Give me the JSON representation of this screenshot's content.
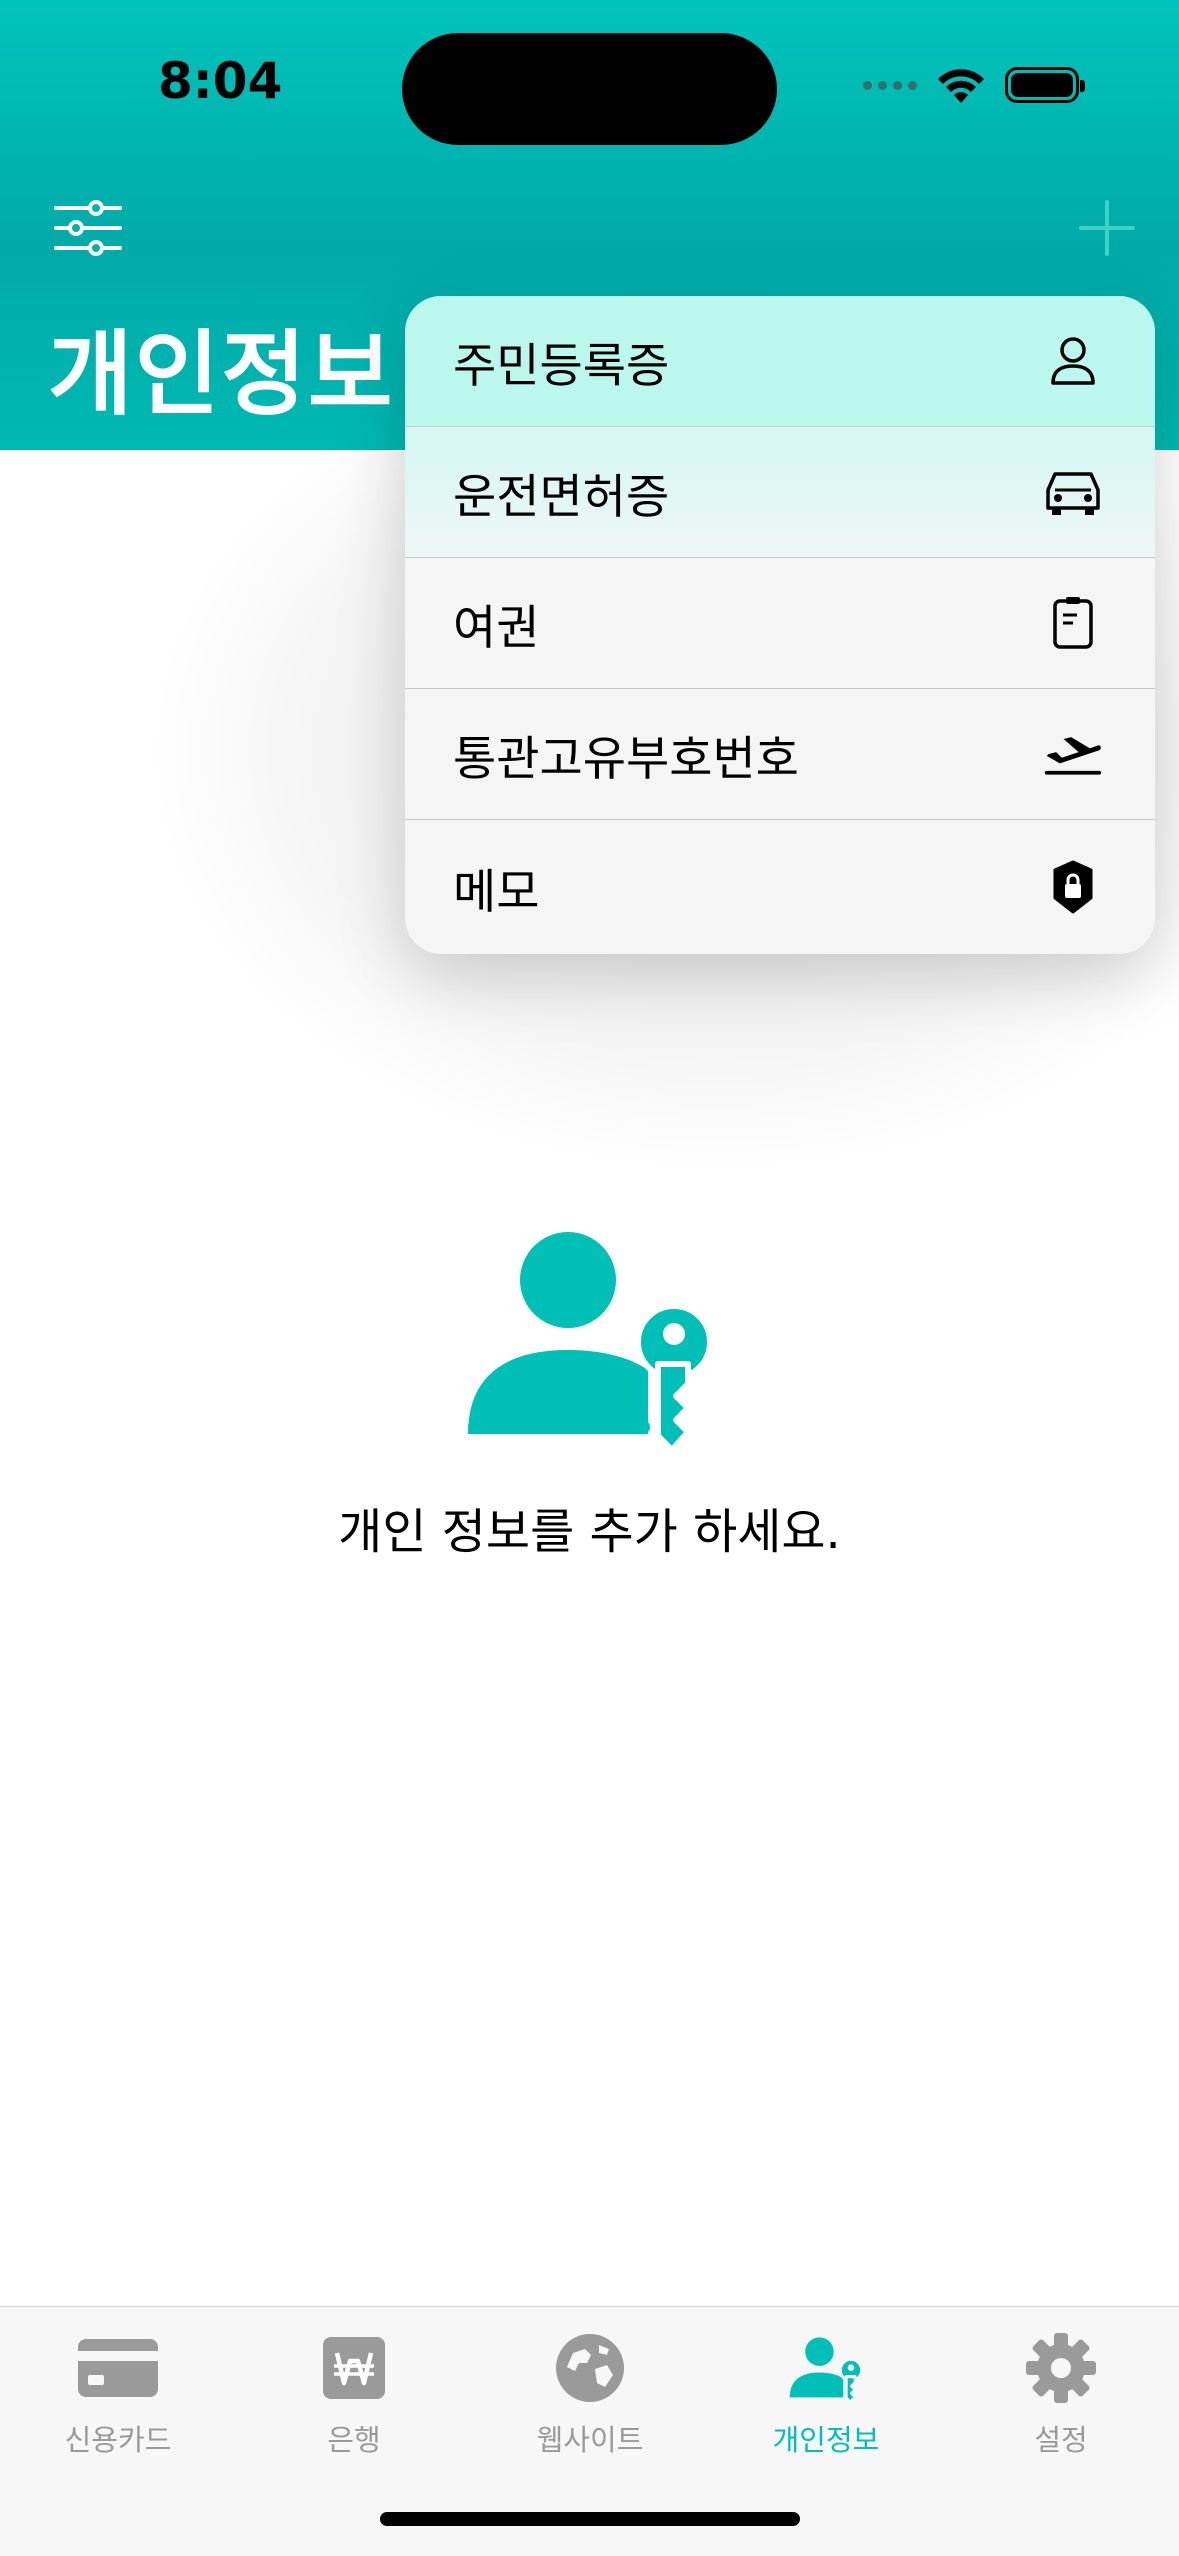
{
  "status_bar": {
    "time": "8:04"
  },
  "header": {
    "title": "개인정보"
  },
  "add_menu": {
    "items": [
      {
        "label": "주민등록증",
        "icon": "person-icon"
      },
      {
        "label": "운전면허증",
        "icon": "car-icon"
      },
      {
        "label": "여권",
        "icon": "passport-icon"
      },
      {
        "label": "통관고유부호번호",
        "icon": "airplane-icon"
      },
      {
        "label": "메모",
        "icon": "lock-shield-icon"
      }
    ]
  },
  "empty_state": {
    "message": "개인 정보를 추가 하세요.",
    "icon": "person-key-icon"
  },
  "tab_bar": {
    "tabs": [
      {
        "label": "신용카드",
        "icon": "credit-card-icon"
      },
      {
        "label": "은행",
        "icon": "won-icon"
      },
      {
        "label": "웹사이트",
        "icon": "globe-icon"
      },
      {
        "label": "개인정보",
        "icon": "person-key-icon",
        "active": true
      },
      {
        "label": "설정",
        "icon": "gear-icon"
      }
    ]
  },
  "colors": {
    "accent": "#00bfb6",
    "inactive": "#9a9a9a",
    "menu_highlight": "#bcf7ee"
  }
}
